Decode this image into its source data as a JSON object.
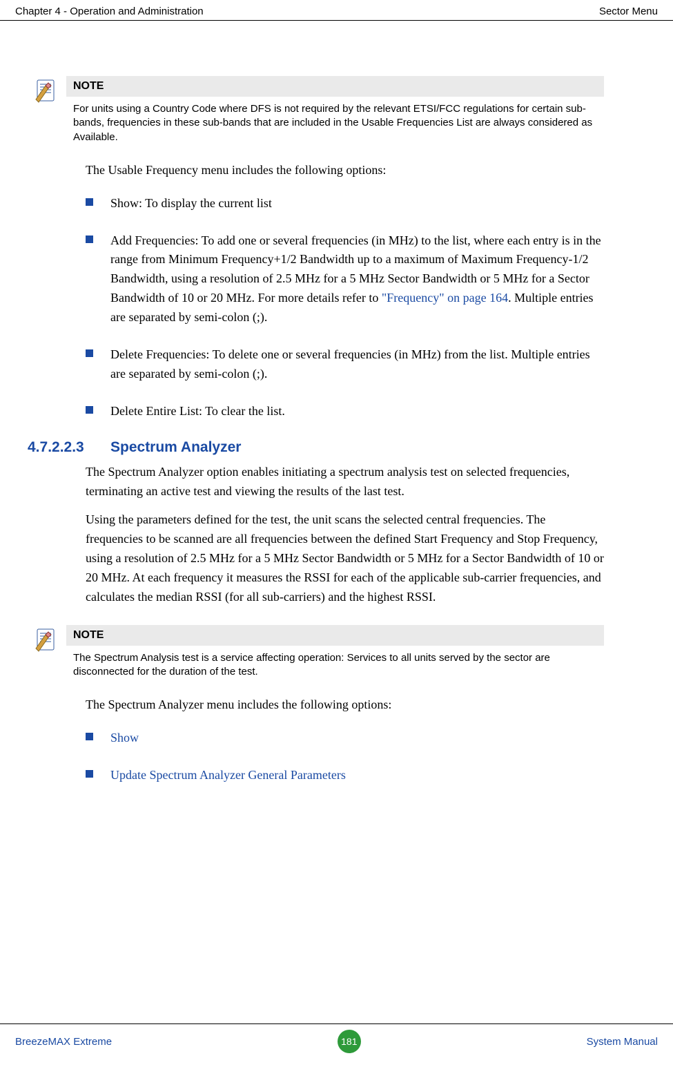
{
  "header": {
    "left": "Chapter 4 - Operation and Administration",
    "right": "Sector Menu"
  },
  "note1": {
    "title": "NOTE",
    "text": "For units using a Country Code where DFS is not required by the relevant ETSI/FCC regulations for certain sub-bands, frequencies in these sub-bands that are included in the Usable Frequencies List are always considered as Available."
  },
  "intro1": "The Usable Frequency menu includes the following options:",
  "bullets1": {
    "b1": "Show: To display the current list",
    "b2a": "Add Frequencies: To add one or several frequencies (in MHz) to the list, where each entry is in the range from Minimum Frequency+1/2 Bandwidth up to a maximum of Maximum Frequency-1/2 Bandwidth, using a resolution of 2.5 MHz for a 5 MHz Sector Bandwidth or 5 MHz for a Sector Bandwidth of 10 or 20 MHz. For more details refer to ",
    "b2_xref": "\"Frequency\" on page 164",
    "b2b": ". Multiple entries are separated by semi-colon (;).",
    "b3": "Delete Frequencies: To delete one or several frequencies (in MHz) from the list. Multiple entries are separated by semi-colon (;).",
    "b4": "Delete Entire List: To clear the list."
  },
  "section": {
    "num": "4.7.2.2.3",
    "title": "Spectrum Analyzer"
  },
  "para1": "The Spectrum Analyzer option enables initiating a spectrum analysis test on selected frequencies, terminating an active test and viewing the results of the last test.",
  "para2": "Using the parameters defined for the test, the unit scans the selected central frequencies. The frequencies to be scanned are all frequencies between the defined Start Frequency and Stop Frequency, using a resolution of 2.5 MHz for a 5 MHz Sector Bandwidth or 5 MHz for a Sector Bandwidth of 10 or 20 MHz. At each frequency it measures the RSSI for each of the applicable sub-carrier frequencies, and calculates the median RSSI (for all sub-carriers) and the highest RSSI.",
  "note2": {
    "title": "NOTE",
    "text": "The Spectrum Analysis test is a service affecting operation: Services to all units served by the sector are disconnected for the duration of the test."
  },
  "intro2": "The Spectrum Analyzer menu includes the following options:",
  "bullets2": {
    "b1": "Show",
    "b2": "Update Spectrum Analyzer General Parameters"
  },
  "footer": {
    "left": "BreezeMAX Extreme",
    "page": "181",
    "right": "System Manual"
  }
}
